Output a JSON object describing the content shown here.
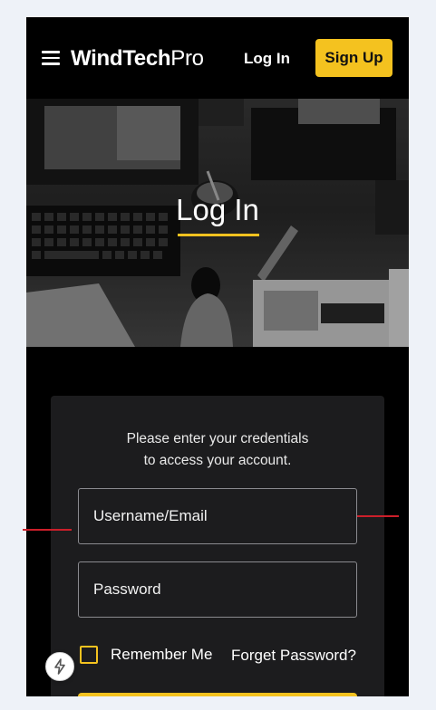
{
  "header": {
    "logo_bold": "WindTech",
    "logo_light": "Pro",
    "login_label": "Log In",
    "signup_label": "Sign Up"
  },
  "hero": {
    "title": "Log In"
  },
  "form": {
    "intro_line1": "Please enter your credentials",
    "intro_line2": "to access your account.",
    "username_placeholder": "Username/Email",
    "password_placeholder": "Password",
    "remember_label": "Remember Me",
    "forgot_label": "Forget Password?"
  },
  "colors": {
    "accent": "#f4c21f",
    "background": "#000000",
    "card": "#1c1c1e",
    "guide_line": "#cc1f2a"
  },
  "icons": {
    "menu": "hamburger-menu-icon",
    "fab": "lightning-bolt-icon"
  }
}
